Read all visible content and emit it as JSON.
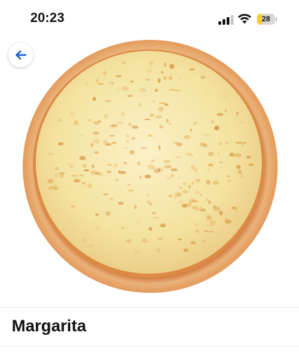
{
  "status_bar": {
    "time": "20:23",
    "battery_level": "28",
    "battery_fraction": 0.28,
    "icons": [
      "signal-icon",
      "wifi-icon",
      "battery-icon"
    ]
  },
  "navigation": {
    "back_icon": "arrow-left-icon"
  },
  "product": {
    "image": "pizza-image",
    "title": "Margarita"
  },
  "colors": {
    "accent": "#1f5fd6",
    "battery": "#f7cf2a",
    "crust": "#e8a864",
    "cheese": "#f4e6a4",
    "sauce": "#d98a3c"
  }
}
